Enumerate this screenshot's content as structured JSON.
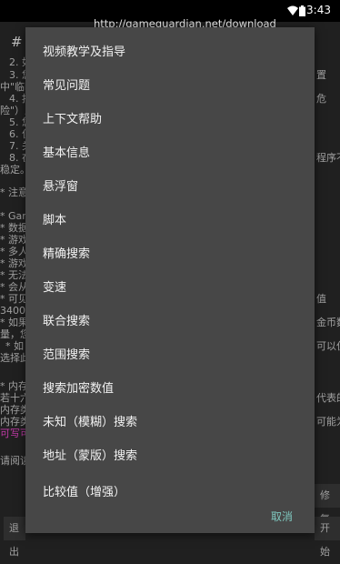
{
  "status": {
    "time": "3:43"
  },
  "url": "http://gameguardian.net/download",
  "background": {
    "lines": [
      "# (",
      "2. 如",
      "3. 您",
      "中\"临时",
      "4. 按",
      "险\"）从",
      "5. 您",
      "6. 位",
      "7. 关",
      "8. 在",
      "稳定。",
      "* 注意",
      "* Gam",
      "* 数据",
      "* 游戏",
      "* 多人",
      "* 游戏",
      "* 无法",
      "* 会从",
      "* 可见",
      "34000",
      "* 如果",
      "量，您",
      "* 如",
      "选择此",
      "* 内存",
      "若十六",
      "内存类",
      "内存类",
      "可写可",
      "请阅读"
    ],
    "right_fragments": [
      "置",
      "危",
      "程序不",
      "值",
      "金币数",
      "可以仅",
      "代表的",
      "可能为"
    ],
    "buttons": {
      "repair": "修复",
      "exit": "退出",
      "start": "开始"
    }
  },
  "menu": {
    "items": [
      "视频教学及指导",
      "常见问题",
      "上下文帮助",
      "基本信息",
      "悬浮窗",
      "脚本",
      "精确搜索",
      "变速",
      "联合搜索",
      "范围搜索",
      "搜索加密数值",
      "未知（模糊）搜索",
      "地址（蒙版）搜索",
      "比较值（增强）"
    ],
    "cancel_label": "取消"
  }
}
